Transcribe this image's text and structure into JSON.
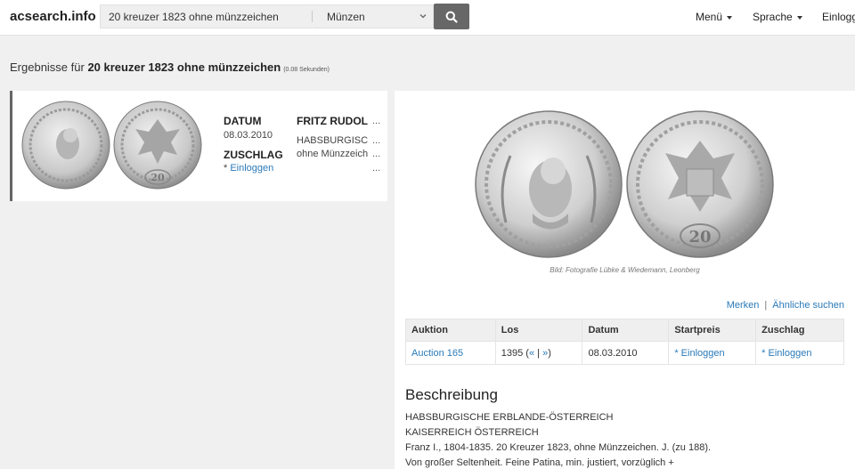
{
  "header": {
    "logo": "acsearch.info",
    "search_value": "20 kreuzer 1823 ohne münzzeichen",
    "category": "Münzen",
    "nav": {
      "menu": "Menü",
      "language": "Sprache",
      "login": "Einlogg"
    }
  },
  "results": {
    "prefix": "Ergebnisse für ",
    "query": "20 kreuzer 1823 ohne münzzeichen",
    "time": "(0.08 Sekunden)"
  },
  "card": {
    "date_label": "DATUM",
    "date_value": "08.03.2010",
    "price_label": "ZUSCHLAG",
    "price_star": "* ",
    "price_link": "Einloggen",
    "house": "FRITZ RUDOLF",
    "line1": "HABSBURGISCHE",
    "line2": "ohne Münzzeichen",
    "ellipsis": "..."
  },
  "detail": {
    "caption": "Bild: Fotografie Lübke & Wiedemann, Leonberg",
    "bookmark": "Merken",
    "divider": "|",
    "similar": "Ähnliche suchen",
    "table": {
      "headers": [
        "Auktion",
        "Los",
        "Datum",
        "Startpreis",
        "Zuschlag"
      ],
      "auction": "Auction 165",
      "lot": "1395 (",
      "prev": "«",
      "mid": " | ",
      "next": "»",
      "lot_end": ")",
      "date": "08.03.2010",
      "start_star": "* ",
      "start_link": "Einloggen",
      "hammer_star": "* ",
      "hammer_link": "Einloggen"
    },
    "description_title": "Beschreibung",
    "description": [
      "HABSBURGISCHE ERBLANDE-ÖSTERREICH",
      "KAISERREICH ÖSTERREICH",
      "Franz I., 1804-1835. 20 Kreuzer 1823, ohne Münzzeichen. J.  (zu 188).",
      "Von großer Seltenheit. Feine Patina, min. justiert, vorzüglich +"
    ]
  },
  "colors": {
    "link": "#2a7ab8",
    "button": "#676767",
    "accent_border": "#666666"
  }
}
